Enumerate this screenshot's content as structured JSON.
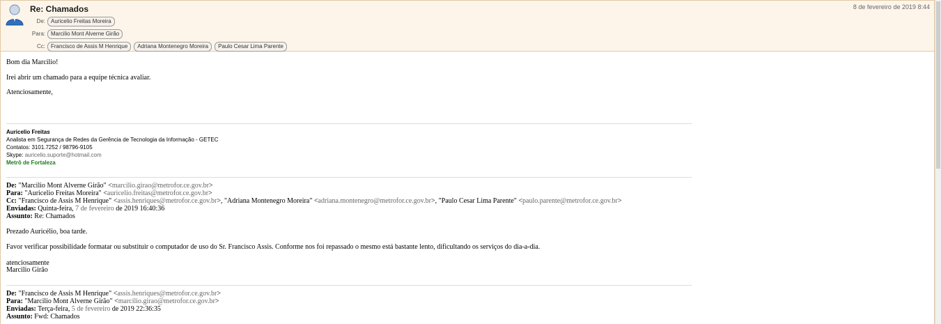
{
  "header": {
    "subject": "Re: Chamados",
    "date": "8 de fevereiro de 2019 8:44",
    "from_label": "De:",
    "from": "Auricelio Freitas Moreira",
    "to_label": "Para:",
    "to": "Marcilio Mont Alverne Girão",
    "cc_label": "Cc:",
    "cc": [
      "Francisco de Assis M Henrique",
      "Adriana Montenegro Moreira",
      "Paulo Cesar Lima Parente"
    ]
  },
  "body": {
    "greeting": "Bom dia Marcilio!",
    "line1": "Irei abrir um chamado para a equipe técnica avaliar.",
    "closing": "Atenciosamente,",
    "signature": {
      "name": "Auricelio Freitas",
      "role": "Analista em Segurança de Redes da Gerência de Tecnologia da Informação - GETEC",
      "contacts": "Contatos: 3101.7252 / 98796-9105",
      "skype_label": "Skype: ",
      "skype": "auricelio.suporte@hotmail.com",
      "company": "Metrô de Fortaleza"
    },
    "quote1": {
      "de_label": "De:",
      "de_name": " \"Marcilio Mont Alverne Girão\" <",
      "de_email": "marcilio.girao@metrofor.ce.gov.br",
      "para_label": "Para:",
      "para_name": " \"Auricelio Freitas Moreira\" <",
      "para_email": "auricelio.freitas@metrofor.ce.gov.br",
      "cc_label": "Cc:",
      "cc1_name": " \"Francisco de Assis M Henrique\" <",
      "cc1_email": "assis.henriques@metrofor.ce.gov.br",
      "cc2_name": ">, \"Adriana Montenegro Moreira\" <",
      "cc2_email": "adriana.montenegro@metrofor.ce.gov.br",
      "cc3_name": ">, \"Paulo Cesar Lima Parente\" <",
      "cc3_email": "paulo.parente@metrofor.ce.gov.br",
      "enviadas_label": "Enviadas:",
      "enviadas_day": " Quinta-feira, ",
      "enviadas_date": "7 de fevereiro",
      "enviadas_rest": " de 2019 16:40:36",
      "assunto_label": "Assunto:",
      "assunto": " Re: Chamados",
      "greeting": "Prezado Auricélio, boa tarde.",
      "text": "Favor verificar possibilidade formatar ou substituir o computador de uso do Sr. Francisco Assis. Conforme nos foi repassado o mesmo está bastante lento, dificultando os serviços do dia-a-dia.",
      "signoff": "atenciosamente",
      "signname": "Marcilio Girão"
    },
    "quote2": {
      "de_label": "De:",
      "de_name": " \"Francisco de Assis M Henrique\" <",
      "de_email": "assis.henriques@metrofor.ce.gov.br",
      "para_label": "Para:",
      "para_name": " \"Marcilio Mont Alverne Girão\" <",
      "para_email": "marcilio.girao@metrofor.ce.gov.br",
      "enviadas_label": "Enviadas:",
      "enviadas_day": " Terça-feira, ",
      "enviadas_date": "5 de fevereiro",
      "enviadas_rest": " de 2019 22:36:35",
      "assunto_label": "Assunto:",
      "assunto": " Fwd: Chamados"
    },
    "gt": ">",
    "gt_comma": ">,"
  }
}
